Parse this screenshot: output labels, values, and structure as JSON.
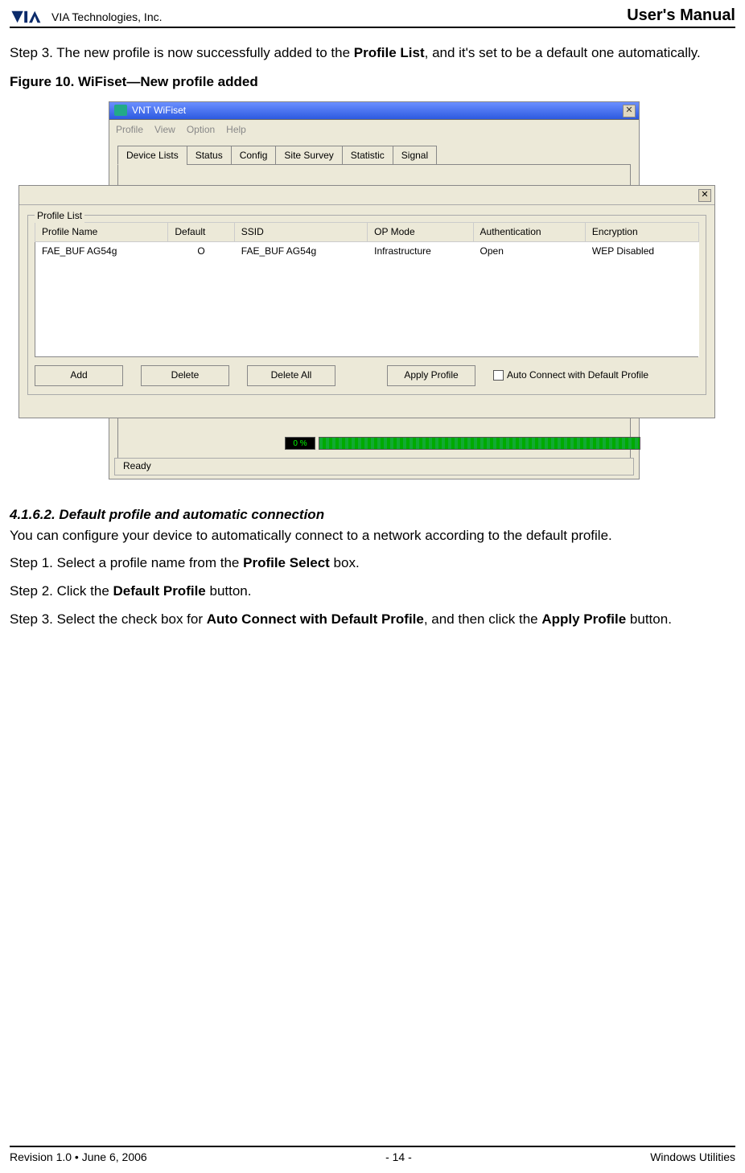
{
  "header": {
    "company": "VIA Technologies, Inc.",
    "manual_title": "User's Manual"
  },
  "step3_top": "Step 3. The new profile is now successfully added to the ",
  "step3_top_bold": "Profile List",
  "step3_top_tail": ", and it's set to be a default one automatically.",
  "figure_caption": "Figure 10. WiFiset—New profile added",
  "vnt": {
    "title": "VNT WiFiset",
    "menu": {
      "profile": "Profile",
      "view": "View",
      "option": "Option",
      "help": "Help"
    },
    "tabs": [
      "Device Lists",
      "Status",
      "Config",
      "Site Survey",
      "Statistic",
      "Signal"
    ],
    "pct": "0 %",
    "status": "Ready"
  },
  "dialog": {
    "group": "Profile List",
    "columns": [
      "Profile Name",
      "Default",
      "SSID",
      "OP Mode",
      "Authentication",
      "Encryption"
    ],
    "row": {
      "name": "FAE_BUF AG54g",
      "default": "O",
      "ssid": "FAE_BUF AG54g",
      "op": "Infrastructure",
      "auth": "Open",
      "enc": "WEP Disabled"
    },
    "buttons": {
      "add": "Add",
      "delete": "Delete",
      "delete_all": "Delete All",
      "apply": "Apply Profile"
    },
    "auto_connect": "Auto Connect with Default Profile"
  },
  "section": {
    "heading": "4.1.6.2.  Default profile and automatic connection",
    "intro": "You can configure your device to automatically connect to a network according to the default profile.",
    "step1_pre": "Step 1. Select a profile name from the ",
    "step1_b": "Profile Select",
    "step1_post": " box.",
    "step2_pre": "Step 2. Click the ",
    "step2_b": "Default Profile",
    "step2_post": " button.",
    "step3_pre": "Step 3. Select the check box for ",
    "step3_b1": "Auto Connect with Default Profile",
    "step3_mid": ", and then click the ",
    "step3_b2": "Apply Profile",
    "step3_post": " button."
  },
  "footer": {
    "left": "Revision 1.0 • June 6, 2006",
    "center": "- 14 -",
    "right": "Windows Utilities"
  }
}
